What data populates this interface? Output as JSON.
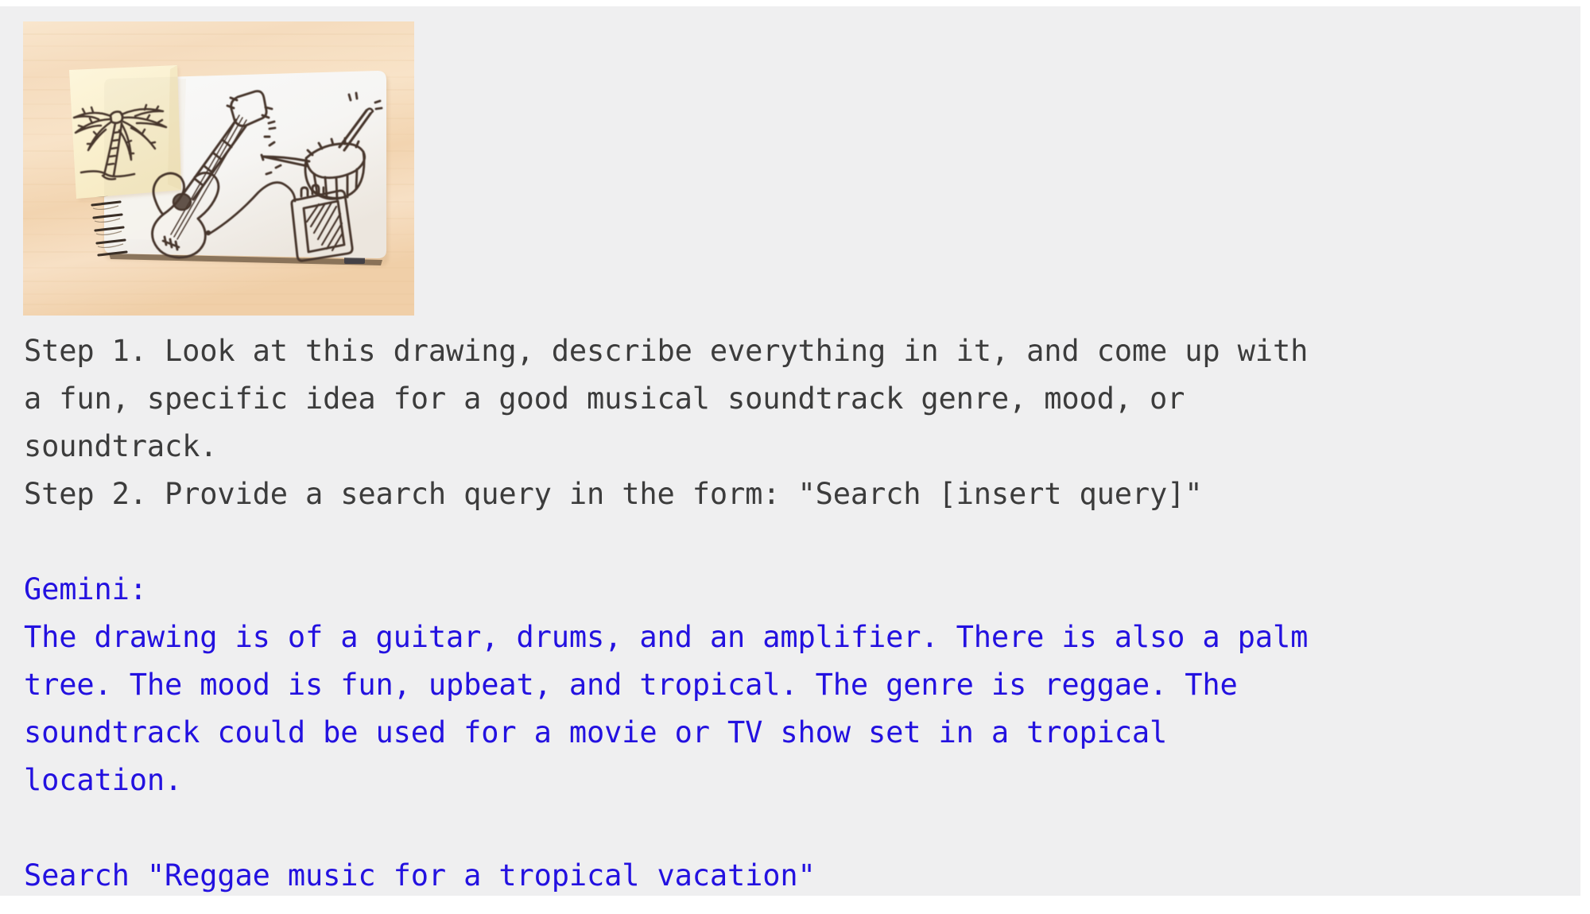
{
  "theme": {
    "page_background": "#ffffff",
    "panel_background": "#efeff0",
    "user_text_color": "#3c3c3c",
    "model_text_color": "#2311e0"
  },
  "photo": {
    "alt": "Overhead photo of an open spiral sketchbook on a light wood desk, showing felt-tip line drawings of an acoustic guitar, a snare drum with a drumstick, and a guitar amplifier connected by a cable, with a yellow sticky note bearing a palm tree drawing laid over the left page.",
    "caption_subjects": [
      "palm tree",
      "acoustic guitar",
      "snare drum",
      "drumstick",
      "amplifier",
      "cable",
      "spiral sketchbook",
      "sticky note",
      "wooden desk"
    ],
    "colors": {
      "desk_wood_light": "#f6ddc0",
      "desk_wood_mid": "#f0d0ab",
      "paper_white": "#fbfaf8",
      "sticky_note": "#fbf1cf",
      "ink": "#4a382e",
      "spiral_metal": "#3a2f28"
    }
  },
  "transcript": {
    "user": {
      "speaker": "",
      "lines": [
        "Step 1. Look at this drawing, describe everything in it, and come up with",
        "a fun, specific idea for a good musical soundtrack genre, mood, or",
        "soundtrack.",
        "Step 2. Provide a search query in the form: \"Search [insert query]\""
      ]
    },
    "spacer_1": " ",
    "model": {
      "speaker": "Gemini:",
      "lines": [
        "The drawing is of a guitar, drums, and an amplifier. There is also a palm",
        "tree. The mood is fun, upbeat, and tropical. The genre is reggae. The",
        "soundtrack could be used for a movie or TV show set in a tropical",
        "location."
      ]
    },
    "spacer_2": " ",
    "search_line": "Search \"Reggae music for a tropical vacation\""
  }
}
